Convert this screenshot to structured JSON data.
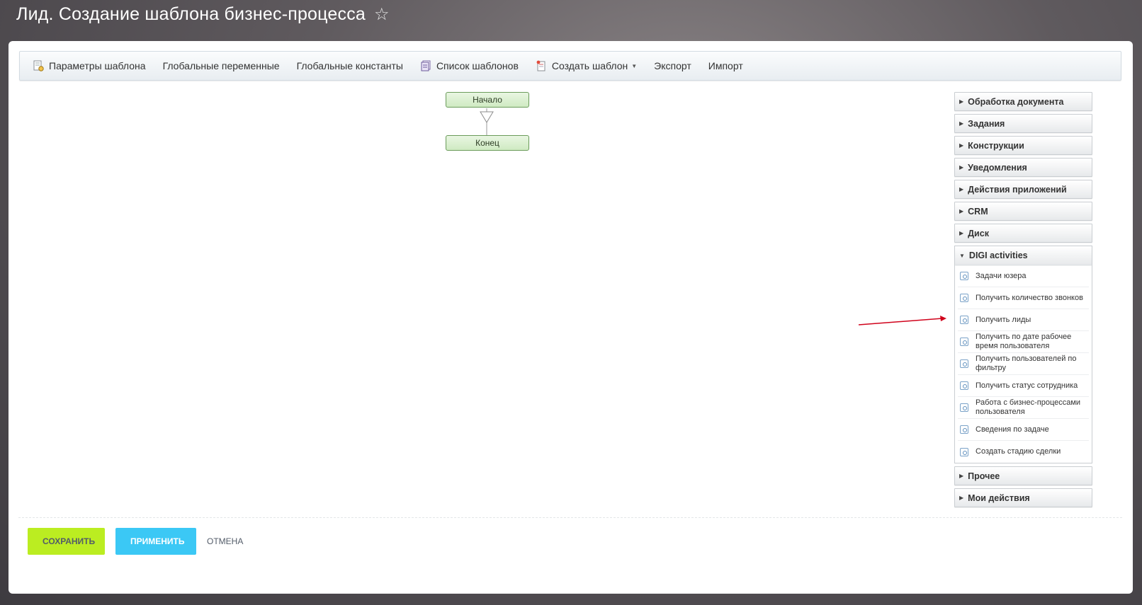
{
  "page": {
    "title": "Лид. Создание шаблона бизнес-процесса"
  },
  "toolbar": {
    "template_params": "Параметры шаблона",
    "global_vars": "Глобальные переменные",
    "global_consts": "Глобальные константы",
    "template_list": "Список шаблонов",
    "create_template": "Создать шаблон",
    "export": "Экспорт",
    "import": "Импорт"
  },
  "diagram": {
    "start": "Начало",
    "end": "Конец"
  },
  "palette": {
    "groups": [
      "Обработка документа",
      "Задания",
      "Конструкции",
      "Уведомления",
      "Действия приложений",
      "CRM",
      "Диск"
    ],
    "open_group": {
      "title": "DIGI activities",
      "items": [
        "Задачи юзера",
        "Получить количество звонков",
        "Получить лиды",
        "Получить по дате рабочее время пользователя",
        "Получить пользователей по фильтру",
        "Получить статус сотрудника",
        "Работа с бизнес-процессами пользователя",
        "Сведения по задаче",
        "Создать стадию сделки"
      ]
    },
    "after_groups": [
      "Прочее",
      "Мои действия"
    ]
  },
  "footer": {
    "save": "СОХРАНИТЬ",
    "apply": "ПРИМЕНИТЬ",
    "cancel": "ОТМЕНА"
  },
  "colors": {
    "save_button": "#bbed21",
    "apply_button": "#3bc8f5",
    "annotation_arrow": "#d0021b",
    "node_fill": "#cfeac2"
  },
  "icons": {
    "favorite": "star-outline-icon",
    "activity": "activity-square-icon"
  }
}
